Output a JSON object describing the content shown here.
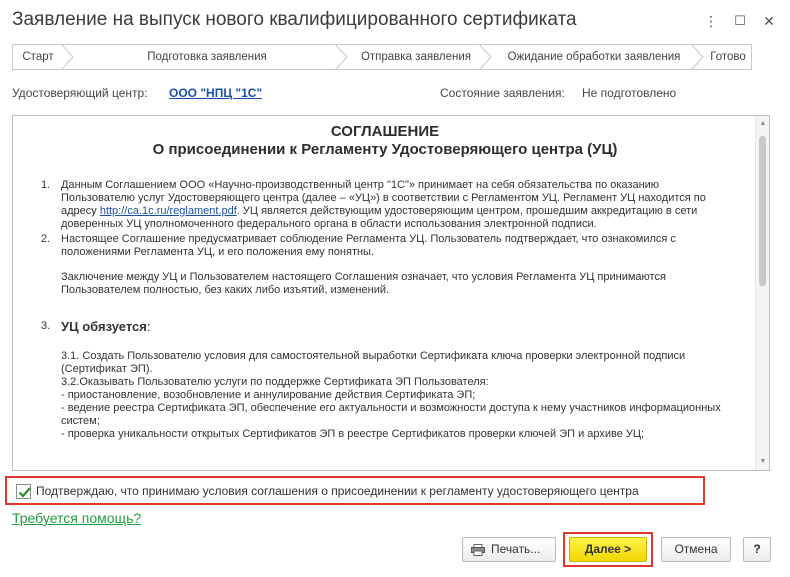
{
  "window": {
    "title": "Заявление на выпуск нового квалифицированного сертификата",
    "more_glyph": "⋮",
    "maximize_glyph": "☐",
    "close_glyph": "✕"
  },
  "steps": [
    {
      "label": "Старт"
    },
    {
      "label": "Подготовка заявления"
    },
    {
      "label": "Отправка заявления"
    },
    {
      "label": "Ожидание обработки заявления"
    },
    {
      "label": "Готово"
    }
  ],
  "info": {
    "ca_label": "Удостоверяющий центр:",
    "ca_value": "ООО \"НПЦ \"1С\"",
    "status_label": "Состояние заявления:",
    "status_value": "Не подготовлено"
  },
  "document": {
    "title_line1": "СОГЛАШЕНИЕ",
    "title_line2": "О присоединении к Регламенту Удостоверяющего центра (УЦ)",
    "item1_num": "1.",
    "item1_text_before": "Данным Соглашением ООО «Научно-производственный центр \"1С\"» принимает на себя обязательства по оказанию Пользователю услуг Удостоверяющего центра (далее – «УЦ») в соответствии с Регламентом УЦ. Регламент УЦ находится по адресу ",
    "item1_link": "http://ca.1c.ru/reglament.pdf",
    "item1_text_after": ". УЦ является действующим удостоверяющим центром, прошедшим аккредитацию в сети доверенных УЦ уполномоченного федерального органа в области использования электронной подписи.",
    "item2_num": "2.",
    "item2_text": "Настоящее Соглашение предусматривает соблюдение Регламента УЦ. Пользователь подтверждает, что ознакомился с положениями Регламента УЦ, и его положения ему понятны.",
    "item2_text2": "Заключение между УЦ и Пользователем настоящего Соглашения означает, что условия Регламента УЦ принимаются Пользователем полностью, без каких либо изъятий, изменений.",
    "item3_num": "3.",
    "item3_head": "УЦ обязуется",
    "item3_head_colon": ":",
    "sub_lines": [
      "3.1. Создать Пользователю условия для самостоятельной выработки Сертификата ключа проверки электронной подписи (Сертификат ЭП).",
      "3.2.Оказывать Пользователю услуги по поддержке Сертификата ЭП Пользователя:",
      "-    приостановление, возобновление и аннулирование действия Сертификата ЭП;",
      "-    ведение реестра Сертификата ЭП, обеспечение его актуальности и возможности доступа к нему участников информационных систем;",
      "-    проверка уникальности открытых Сертификатов ЭП в реестре Сертификатов проверки ключей ЭП и архиве УЦ;"
    ]
  },
  "agreement": {
    "checked": true,
    "label": "Подтверждаю, что принимаю условия соглашения о присоединении к регламенту удостоверяющего центра"
  },
  "help_link": "Требуется помощь?",
  "buttons": {
    "print": "Печать...",
    "next": "Далее >",
    "cancel": "Отмена",
    "help": "?"
  },
  "colors": {
    "highlight_red": "#e0352a",
    "primary_yellow": "#f5e000",
    "link_blue": "#1a4fa8",
    "help_green": "#1f9e3d"
  }
}
